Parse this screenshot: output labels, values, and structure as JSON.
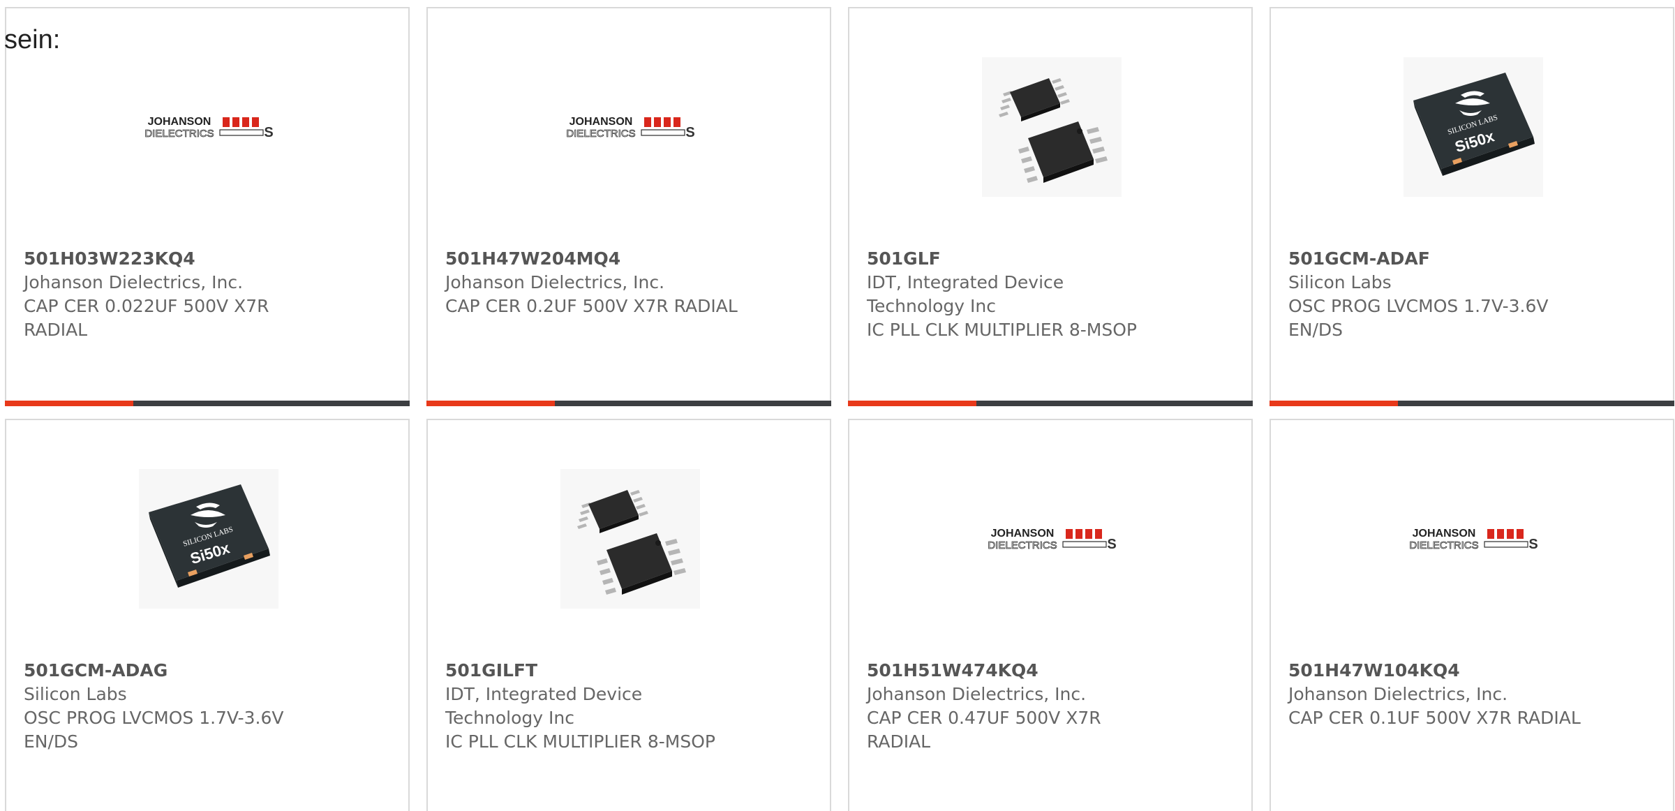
{
  "prefix_text": "sein:",
  "colors": {
    "card_border": "#d9d9d9",
    "part_text": "#555555",
    "detail_text": "#666666",
    "accent_red": "#e8391a",
    "accent_dark": "#3d3f42",
    "johanson_red": "#d9271c"
  },
  "logos": {
    "johanson_top": "JOHANSON",
    "johanson_bottom": "DIELECTRICS",
    "silicon_labs_brand": "SILICON LABS",
    "silicon_labs_model": "Si50x"
  },
  "products": [
    {
      "part": "501H03W223KQ4",
      "manufacturer": "Johanson Dielectrics, Inc.",
      "desc_line1": "CAP CER 0.022UF 500V X7R",
      "desc_line2": "RADIAL",
      "image": "johanson-logo"
    },
    {
      "part": "501H47W204MQ4",
      "manufacturer": "Johanson Dielectrics, Inc.",
      "desc_line1": "CAP CER 0.2UF 500V X7R RADIAL",
      "image": "johanson-logo"
    },
    {
      "part": "501GLF",
      "manufacturer_line1": "IDT, Integrated Device",
      "manufacturer_line2": "Technology Inc",
      "desc_line1": "IC PLL CLK MULTIPLIER 8-MSOP",
      "image": "msop-chip"
    },
    {
      "part": "501GCM-ADAF",
      "manufacturer": "Silicon Labs",
      "desc_line1": "OSC PROG LVCMOS 1.7V-3.6V",
      "desc_line2": "EN/DS",
      "image": "si50x-chip"
    },
    {
      "part": "501GCM-ADAG",
      "manufacturer": "Silicon Labs",
      "desc_line1": "OSC PROG LVCMOS 1.7V-3.6V",
      "desc_line2": "EN/DS",
      "image": "si50x-chip"
    },
    {
      "part": "501GILFT",
      "manufacturer_line1": "IDT, Integrated Device",
      "manufacturer_line2": "Technology Inc",
      "desc_line1": "IC PLL CLK MULTIPLIER 8-MSOP",
      "image": "msop-chip"
    },
    {
      "part": "501H51W474KQ4",
      "manufacturer": "Johanson Dielectrics, Inc.",
      "desc_line1": "CAP CER 0.47UF 500V X7R",
      "desc_line2": "RADIAL",
      "image": "johanson-logo"
    },
    {
      "part": "501H47W104KQ4",
      "manufacturer": "Johanson Dielectrics, Inc.",
      "desc_line1": "CAP CER 0.1UF 500V X7R RADIAL",
      "image": "johanson-logo"
    }
  ]
}
